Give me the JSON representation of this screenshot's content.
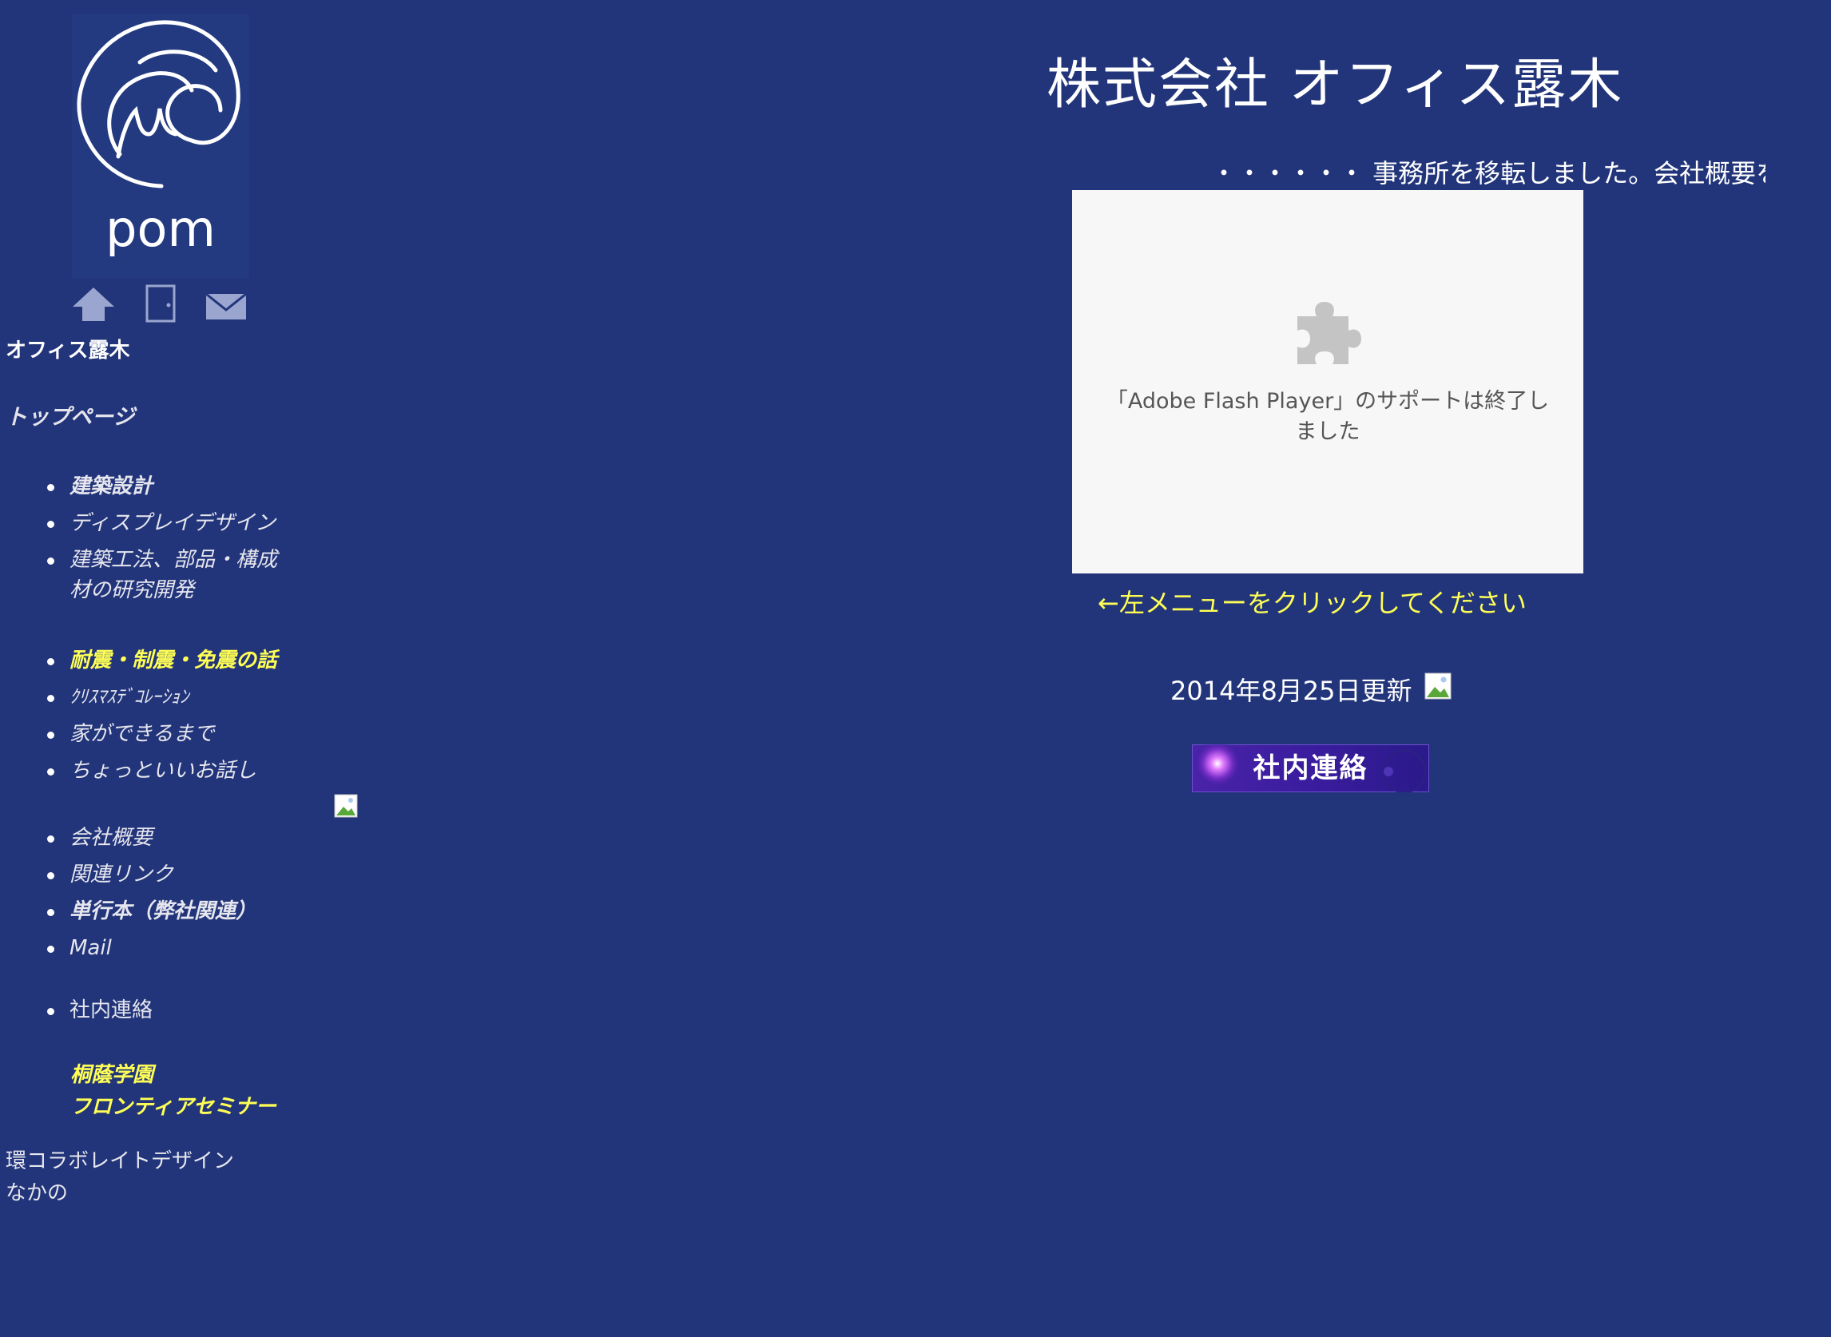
{
  "logo": {
    "text": "pom"
  },
  "nav_icons": [
    {
      "name": "home-icon"
    },
    {
      "name": "door-icon"
    },
    {
      "name": "mail-icon"
    }
  ],
  "sidebar": {
    "company_short": "オフィス露木",
    "top_link": "トップページ",
    "menu_group_1": [
      "建築設計",
      "ディスプレイデザイン",
      "建築工法、部品・構成材の研究開発"
    ],
    "menu_group_2": [
      "耐震・制震・免震の話",
      "ｸﾘｽﾏｽﾃﾞｺﾚｰｼｮﾝ",
      "家ができるまで",
      "ちょっといいお話し"
    ],
    "menu_group_3": [
      "会社概要",
      "関連リンク",
      "単行本（弊社関連）",
      "Mail"
    ],
    "menu_group_4": [
      "社内連絡"
    ],
    "yellow_links": [
      "桐蔭学園",
      "フロンティアセミナー"
    ],
    "bottom_links": [
      "環コラボレイトデザイン",
      "なかの"
    ]
  },
  "main": {
    "title": "株式会社 オフィス露木",
    "marquee": "・・・・・・ 事務所を移転しました。会社概要を",
    "flash_message": "「Adobe Flash Player」のサポートは終了しました",
    "hint": "←左メニューをクリックしてください",
    "updated": "2014年8月25日更新",
    "banner_label": "社内連絡"
  },
  "colors": {
    "background": "#22357a",
    "link_yellow": "#ffff55",
    "banner_purple": "#3a1c9e"
  }
}
